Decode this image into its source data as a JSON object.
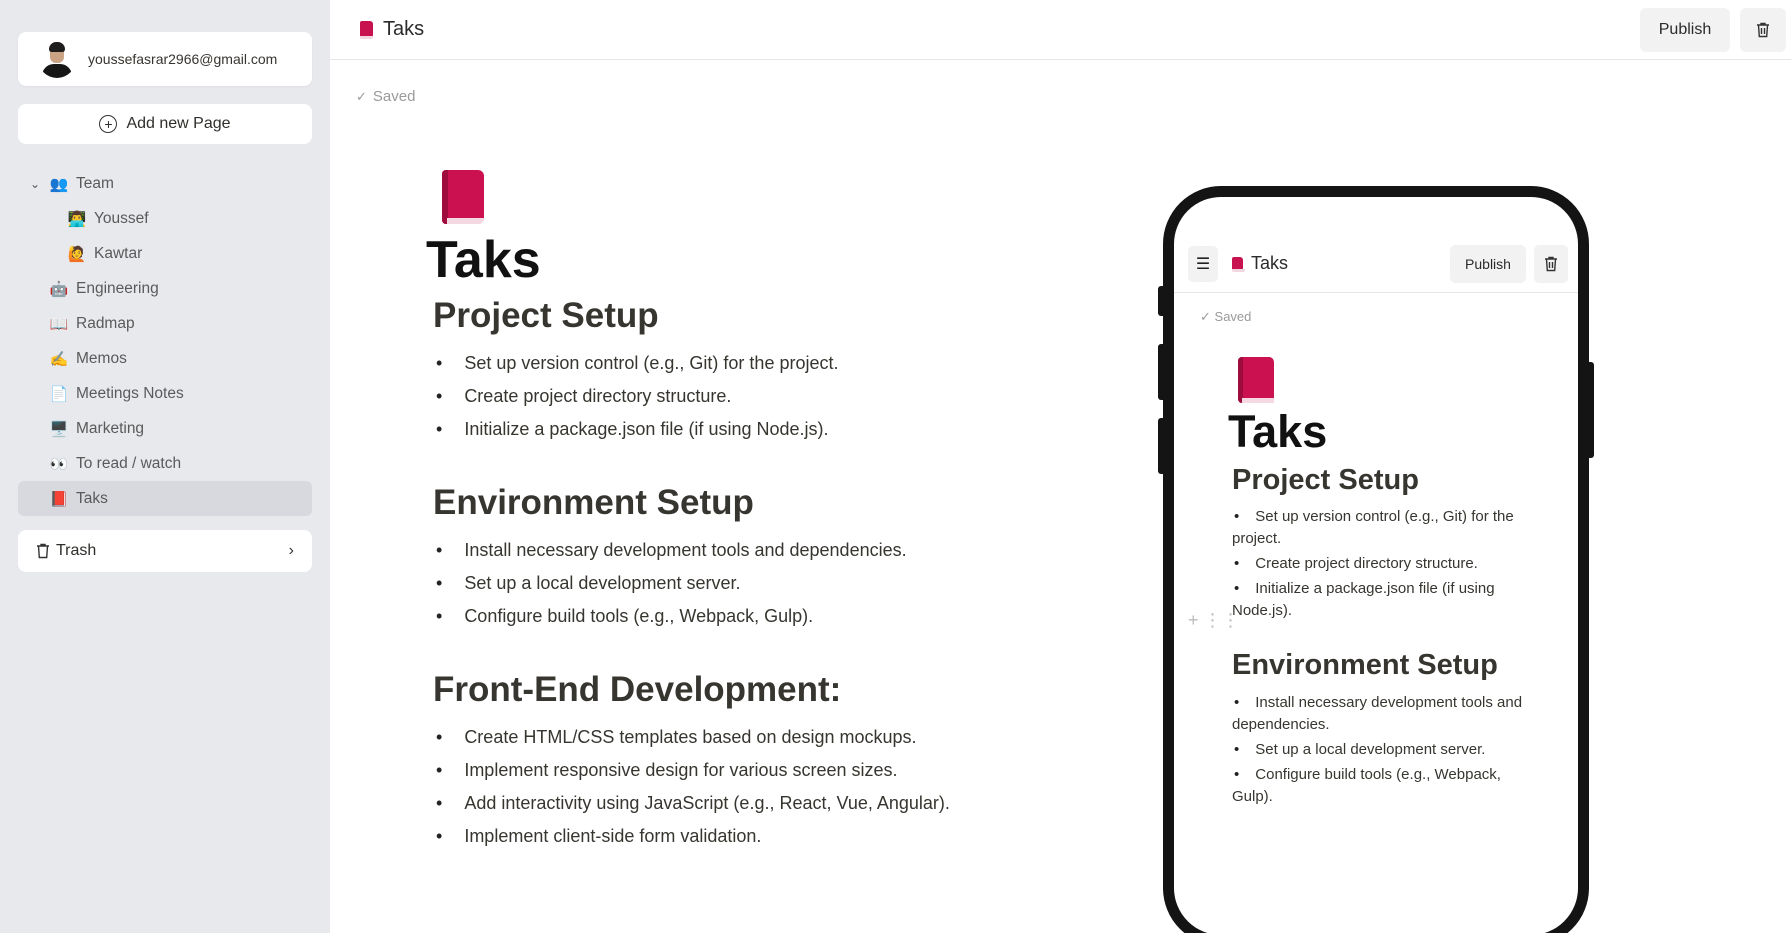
{
  "sidebar": {
    "user_email": "youssefasrar2966@gmail.com",
    "add_page_label": "Add new Page",
    "items": [
      {
        "label": "Team",
        "emoji": "👥"
      },
      {
        "label": "Youssef",
        "emoji": "👨‍💻"
      },
      {
        "label": "Kawtar",
        "emoji": "🙋"
      },
      {
        "label": "Engineering",
        "emoji": "🤖"
      },
      {
        "label": "Radmap",
        "emoji": "📖"
      },
      {
        "label": "Memos",
        "emoji": "✍️"
      },
      {
        "label": "Meetings Notes",
        "emoji": "📄"
      },
      {
        "label": "Marketing",
        "emoji": "🖥️"
      },
      {
        "label": "To read / watch",
        "emoji": "👀"
      },
      {
        "label": "Taks",
        "emoji": "📕"
      }
    ],
    "trash_label": "Trash"
  },
  "header": {
    "title": "Taks",
    "publish_label": "Publish"
  },
  "status": {
    "saved_label": "Saved"
  },
  "document": {
    "title": "Taks",
    "sections": [
      {
        "heading": "Project Setup",
        "items": [
          "Set up version control (e.g., Git) for the project.",
          "Create project directory structure.",
          "Initialize a package.json file (if using Node.js)."
        ]
      },
      {
        "heading": "Environment Setup",
        "items": [
          "Install necessary development tools and dependencies.",
          "Set up a local development server.",
          "Configure build tools (e.g., Webpack, Gulp)."
        ]
      },
      {
        "heading": "Front-End Development:",
        "items": [
          "Create HTML/CSS templates based on design mockups.",
          "Implement responsive design for various screen sizes.",
          "Add interactivity using JavaScript (e.g., React, Vue, Angular).",
          "Implement client-side form validation."
        ]
      }
    ]
  },
  "phone_preview": {
    "title": "Taks",
    "publish_label": "Publish",
    "saved_label": "Saved",
    "doc_title": "Taks",
    "sections": [
      {
        "heading": "Project Setup",
        "items": [
          "Set up version control (e.g., Git) for the project.",
          "Create project directory structure.",
          "Initialize a package.json file (if using Node.js)."
        ]
      },
      {
        "heading": "Environment Setup",
        "items": [
          "Install necessary development tools and dependencies.",
          "Set up a local development server.",
          "Configure build tools (e.g., Webpack, Gulp)."
        ]
      }
    ]
  }
}
